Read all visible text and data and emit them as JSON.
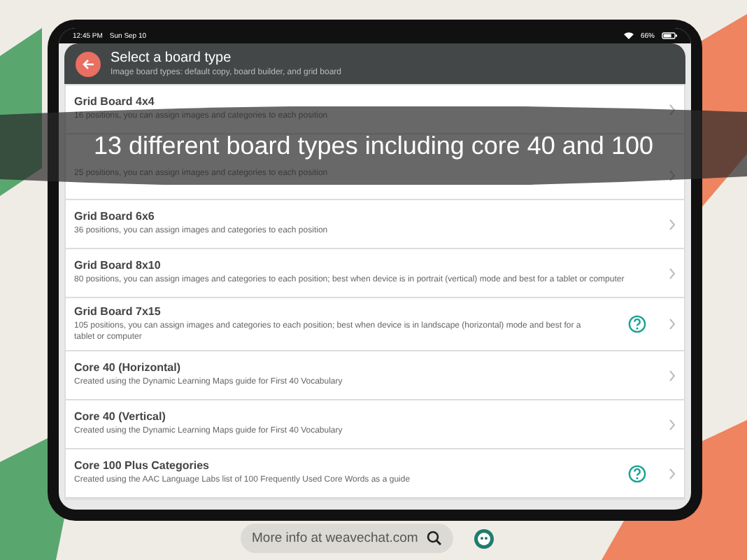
{
  "status_bar": {
    "time": "12:45 PM",
    "date": "Sun Sep 10",
    "battery_text": "66%"
  },
  "header": {
    "title": "Select a board type",
    "subtitle": "Image board types: default copy, board builder, and grid board"
  },
  "boards": [
    {
      "title": "Grid Board 4x4",
      "description": "16 positions, you can assign images and categories to each position",
      "help": false
    },
    {
      "description": "25 positions, you can assign images and categories to each position",
      "help": false
    },
    {
      "title": "Grid Board 6x6",
      "description": "36 positions, you can assign images and categories to each position",
      "help": false
    },
    {
      "title": "Grid Board 8x10",
      "description": "80 positions, you can assign images and categories to each position; best when device is in portrait (vertical) mode and best for a tablet or computer",
      "help": false
    },
    {
      "title": "Grid Board 7x15",
      "description": "105 positions, you can assign images and categories to each position; best when device is in landscape (horizontal) mode and best for a tablet or computer",
      "help": true
    },
    {
      "title": "Core 40 (Horizontal)",
      "description": "Created using the Dynamic Learning Maps guide for First 40 Vocabulary",
      "help": false
    },
    {
      "title": "Core 40 (Vertical)",
      "description": "Created using the Dynamic Learning Maps guide for First 40 Vocabulary",
      "help": false
    },
    {
      "title": "Core 100 Plus Categories",
      "description": "Created using the AAC Language Labs list of 100 Frequently Used Core Words as a guide",
      "help": true
    }
  ],
  "banner": "13 different board types including core 40 and 100",
  "footer": {
    "link": "More info at weavechat.com"
  }
}
